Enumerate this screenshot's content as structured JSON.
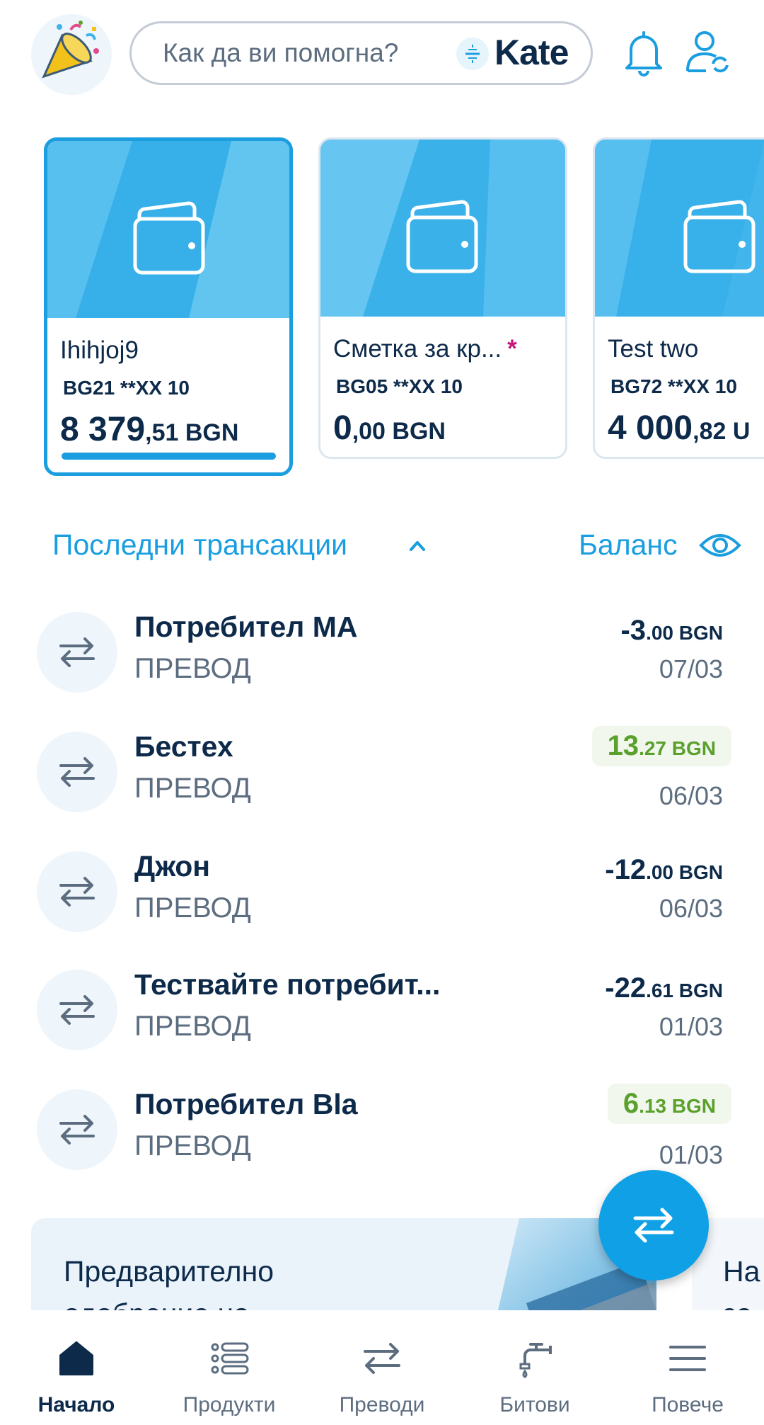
{
  "search": {
    "placeholder": "Как да ви помогна?",
    "assistant_name": "Kate"
  },
  "accounts": [
    {
      "name": "Ihihjoj9",
      "iban": "BG21 **XX 10",
      "balance_int": "8 379",
      "balance_dec": ",51 BGN",
      "selected": true
    },
    {
      "name": "Сметка за кр...",
      "iban": "BG05 **XX 10",
      "balance_int": "0",
      "balance_dec": ",00 BGN",
      "starred": true
    },
    {
      "name": "Test two",
      "iban": "BG72 **XX 10",
      "balance_int": "4 000",
      "balance_dec": ",82 U"
    }
  ],
  "star": "*",
  "transactions_section": {
    "title": "Последни трансакции",
    "balance_label": "Баланс"
  },
  "transactions": [
    {
      "name": "Потребител МА",
      "type": "ПРЕВОД",
      "amount_int": "-3",
      "amount_dec": ".00 BGN",
      "date": "07/03",
      "positive": false
    },
    {
      "name": "Бестех",
      "type": "ПРЕВОД",
      "amount_int": "13",
      "amount_dec": ".27 BGN",
      "date": "06/03",
      "positive": true
    },
    {
      "name": "Джон",
      "type": "ПРЕВОД",
      "amount_int": "-12",
      "amount_dec": ".00 BGN",
      "date": "06/03",
      "positive": false
    },
    {
      "name": "Тествайте потребит...",
      "type": "ПРЕВОД",
      "amount_int": "-22",
      "amount_dec": ".61 BGN",
      "date": "01/03",
      "positive": false
    },
    {
      "name": "Потребител Bla",
      "type": "ПРЕВОД",
      "amount_int": "6",
      "amount_dec": ".13 BGN",
      "date": "01/03",
      "positive": true
    }
  ],
  "promo": {
    "line1": "Предварително",
    "line2": "одобрение на",
    "next_line1": "На",
    "next_line2": "за"
  },
  "nav": [
    {
      "label": "Начало",
      "icon": "home-icon",
      "active": true
    },
    {
      "label": "Продукти",
      "icon": "list-icon"
    },
    {
      "label": "Преводи",
      "icon": "transfer-icon"
    },
    {
      "label": "Битови",
      "icon": "faucet-icon"
    },
    {
      "label": "Повече",
      "icon": "menu-icon"
    }
  ],
  "colors": {
    "accent": "#1a9ee0",
    "text": "#0d2a4a",
    "muted": "#5d6d80",
    "positive": "#5aa02c",
    "card": "#42b6ec"
  }
}
